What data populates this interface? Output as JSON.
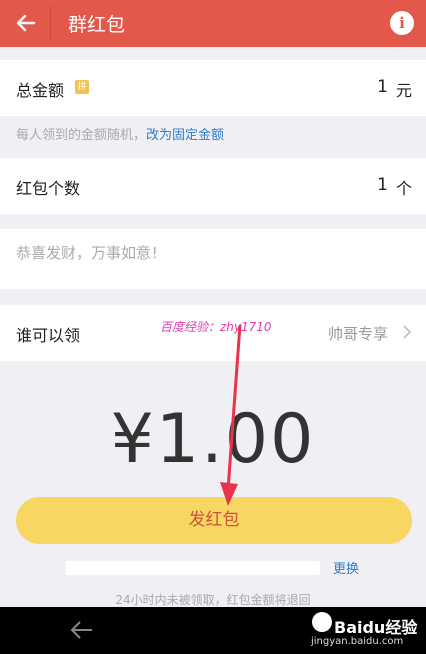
{
  "header": {
    "title": "群红包"
  },
  "total_amount": {
    "label": "总金额",
    "badge": "拼",
    "value": "1",
    "unit": "元"
  },
  "hint": {
    "text": "每人领到的金额随机，",
    "link": "改为固定金额"
  },
  "count": {
    "label": "红包个数",
    "value": "1",
    "unit": "个"
  },
  "greeting": {
    "placeholder": "恭喜发财，万事如意！"
  },
  "who_can_claim": {
    "label": "谁可以领",
    "value": "帅哥专享"
  },
  "watermark": "百度经验：zhy1710",
  "amount_display": "¥1.00",
  "send_button": "发红包",
  "change_link": "更换",
  "footnote": "24小时内未被领取，红包金额将退回",
  "brand": {
    "name": "Baidu经验",
    "url": "jingyan.baidu.com"
  },
  "colors": {
    "header": "#e4574b",
    "button": "#f7d762",
    "link": "#2e7ec9",
    "annotation": "#e8334a"
  }
}
